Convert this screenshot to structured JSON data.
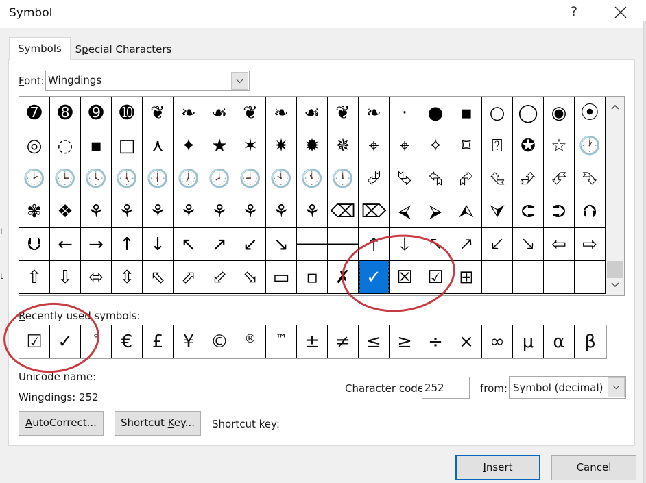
{
  "window": {
    "title": "Symbol",
    "help_label": "?",
    "close_icon": "close-icon"
  },
  "tabs": [
    {
      "label_accel": "S",
      "label_rest": "ymbols",
      "active": true
    },
    {
      "label_pre": "S",
      "label_accel": "p",
      "label_rest": "ecial Characters",
      "active": false
    }
  ],
  "font": {
    "label_accel": "F",
    "label_rest": "ont:",
    "value": "Wingdings"
  },
  "grid": {
    "rows": [
      [
        "➐",
        "➑",
        "➒",
        "➓",
        "❦",
        "❧",
        "☙",
        "❦",
        "❧",
        "☙",
        "❦",
        "❧",
        "·",
        "●",
        "▪",
        "○",
        "◯",
        "◉",
        "⦿"
      ],
      [
        "◎",
        "◌",
        "▪",
        "□",
        "⋏",
        "✦",
        "★",
        "✶",
        "✷",
        "✹",
        "✵",
        "⌖",
        "⌖",
        "✧",
        "⌑",
        "⍰",
        "✪",
        "☆",
        "🕐"
      ],
      [
        "🕑",
        "🕒",
        "🕓",
        "🕔",
        "🕕",
        "🕖",
        "🕗",
        "🕘",
        "🕙",
        "🕚",
        "🕛",
        "⮰",
        "⮱",
        "⮲",
        "⮳",
        "⮴",
        "⮵",
        "⮶",
        "⮷"
      ],
      [
        "✾",
        "❖",
        "⚘",
        "⚘",
        "⚘",
        "⚘",
        "⚘",
        "⚘",
        "⚘",
        "⚘",
        "⌫",
        "⌦",
        "⮘",
        "⮚",
        "⮙",
        "⮛",
        "⮈",
        "⮊",
        "⮉"
      ],
      [
        "⮋",
        "←",
        "→",
        "↑",
        "↓",
        "↖",
        "↗",
        "↙",
        "↘",
        "🡐",
        "🡒",
        "🡑",
        "🡓",
        "🡔",
        "🡕",
        "🡗",
        "🡖",
        "⇦",
        "⇨"
      ],
      [
        "⇧",
        "⇩",
        "⬄",
        "⇳",
        "⬁",
        "⬀",
        "⬃",
        "⬂",
        "▭",
        "▫",
        "✗",
        "✓",
        "☒",
        "☑",
        "⊞",
        "",
        "",
        "",
        ""
      ]
    ],
    "selected": {
      "row": 5,
      "col": 11,
      "symbol": "✓"
    }
  },
  "scrollbar": {
    "up_icon": "chevron-up-icon",
    "down_icon": "chevron-down-icon",
    "position_fraction": 0.95
  },
  "recent": {
    "label_accel": "R",
    "label_rest": "ecently used symbols:",
    "symbols": [
      "☑",
      "✓",
      "°",
      "€",
      "£",
      "¥",
      "©",
      "®",
      "™",
      "±",
      "≠",
      "≤",
      "≥",
      "÷",
      "×",
      "∞",
      "μ",
      "α",
      "β"
    ]
  },
  "info": {
    "unicode_name_label": "Unicode name:",
    "code_info": "Wingdings: 252"
  },
  "charcode": {
    "label_accel": "C",
    "label_rest": "haracter code:",
    "value": "252"
  },
  "from": {
    "label_pre": "fro",
    "label_accel": "m",
    "label_rest": ":",
    "value": "Symbol (decimal)"
  },
  "buttons": {
    "autocorrect_accel": "A",
    "autocorrect_rest": "utoCorrect...",
    "shortcut_pre": "Shortcut ",
    "shortcut_accel": "K",
    "shortcut_rest": "ey...",
    "shortcut_label": "Shortcut key:",
    "insert_accel": "I",
    "insert_rest": "nsert",
    "cancel": "Cancel"
  },
  "annotations": {
    "color": "#c3262e"
  },
  "colors": {
    "selection": "#0a74d8",
    "default_button_border": "#0a64c2"
  }
}
